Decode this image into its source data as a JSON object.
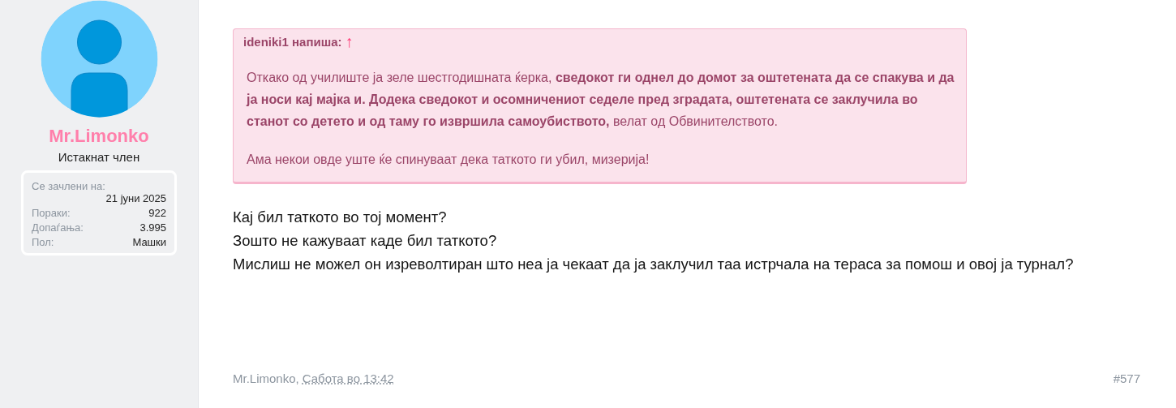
{
  "user": {
    "kind": "picture",
    "name": "Mr.Limonko",
    "title": "Истакнат член",
    "stats": [
      {
        "label": "Се зачлени на:",
        "value": "21 јуни 2025",
        "kind": "stacked"
      },
      {
        "label": "Пораки:",
        "value": "922",
        "kind": "inline"
      },
      {
        "label": "Допаѓања:",
        "value": "3.995",
        "kind": "inline"
      },
      {
        "label": "Пол:",
        "value": "Машки",
        "kind": "inline"
      }
    ]
  },
  "quote": {
    "author": "ideniki1 напиша:",
    "jump": "↑",
    "paragraphs": [
      "Откако од училиште ја зеле шестгодишната ќерка, **сведокот ги однел до домот за оштетената да се спакува и да ја носи кај мајка и. Додека сведокот и осомничениот седеле пред зградата, оштетената се заклучила во станот со детето и од таму го извршила самоубиството,** велат од Обвинителството.",
      "Ама некои овде уште ќе спинуваат дека таткото ги убил, мизерија!"
    ]
  },
  "body": [
    "Кај бил таткото во тој момент?",
    "Зошто не кажуваат каде бил таткото?",
    "Мислиш не можел он изреволтиран што неа ја чекаат да ја заклучил таа истрчала на тераса за помош и овој ја турнал?"
  ],
  "footer": {
    "author": "Mr.Limonko,",
    "date": "Сабота во 13:42",
    "number": "#577"
  }
}
